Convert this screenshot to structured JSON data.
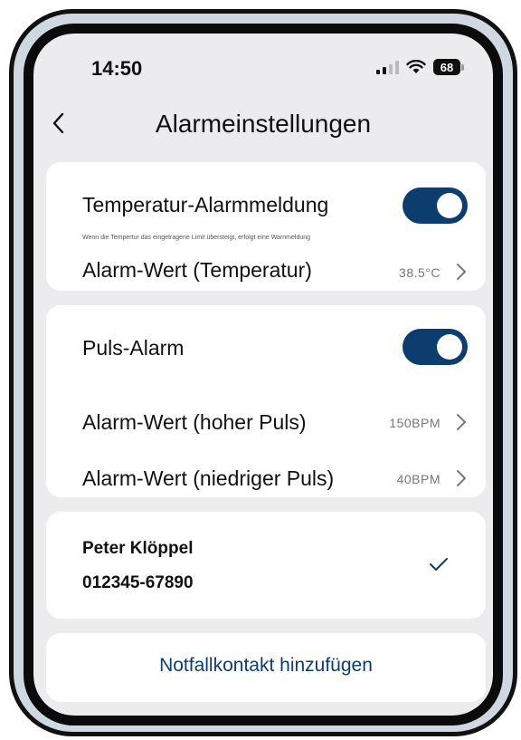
{
  "status_bar": {
    "time": "14:50",
    "battery": "68"
  },
  "header": {
    "title": "Alarmeinstellungen",
    "back_icon": "chevron-left-icon"
  },
  "temperature_card": {
    "toggle_label": "Temperatur-Alarmmeldung",
    "toggle_on": true,
    "hint": "Wenn die Tempertur das eingetragene Limit übersteigt, erfolgt eine Warnmeldung",
    "value_label": "Alarm-Wert (Temperatur)",
    "value": "38.5°C"
  },
  "pulse_card": {
    "toggle_label": "Puls-Alarm",
    "toggle_on": true,
    "high_label": "Alarm-Wert (hoher Puls)",
    "high_value": "150BPM",
    "low_label": "Alarm-Wert (niedriger Puls)",
    "low_value": "40BPM"
  },
  "contact_card": {
    "name": "Peter Klöppel",
    "phone": "012345-67890",
    "selected_icon": "checkmark-icon"
  },
  "add_contact": {
    "label": "Notfallkontakt hinzufügen"
  },
  "colors": {
    "accent": "#0d3d6e",
    "background": "#ececee",
    "card": "#ffffff"
  }
}
